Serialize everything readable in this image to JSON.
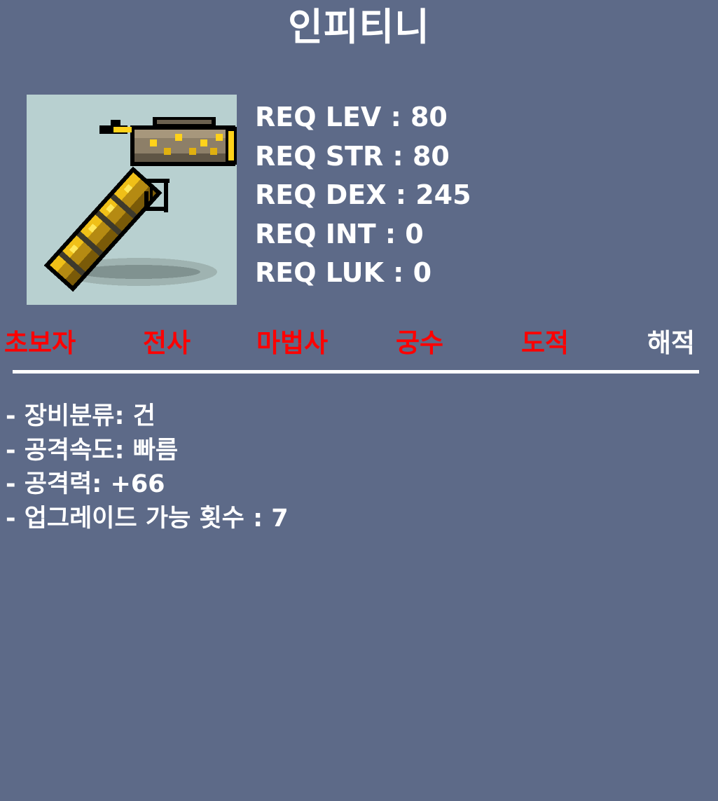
{
  "item": {
    "name": "인피티니",
    "image_icon": "golden-gun-icon"
  },
  "requirements": [
    {
      "label": "REQ LEV : 80"
    },
    {
      "label": "REQ STR : 80"
    },
    {
      "label": "REQ DEX : 245"
    },
    {
      "label": "REQ INT : 0"
    },
    {
      "label": "REQ LUK : 0"
    }
  ],
  "jobs": [
    {
      "label": "초보자",
      "color": "#ff0000"
    },
    {
      "label": "전사",
      "color": "#ff0000"
    },
    {
      "label": "마법사",
      "color": "#ff0000"
    },
    {
      "label": "궁수",
      "color": "#ff0000"
    },
    {
      "label": "도적",
      "color": "#ff0000"
    },
    {
      "label": "해적",
      "color": "#ffffff"
    }
  ],
  "stats": [
    {
      "text": "- 장비분류: 건"
    },
    {
      "text": "- 공격속도: 빠름"
    },
    {
      "text": "- 공격력: +66"
    },
    {
      "text": "- 업그레이드 가능 횟수 : 7"
    }
  ],
  "colors": {
    "background": "#5d6a88",
    "image_background": "#b8d0d0",
    "restricted_job": "#ff0000",
    "allowed_job": "#ffffff"
  }
}
